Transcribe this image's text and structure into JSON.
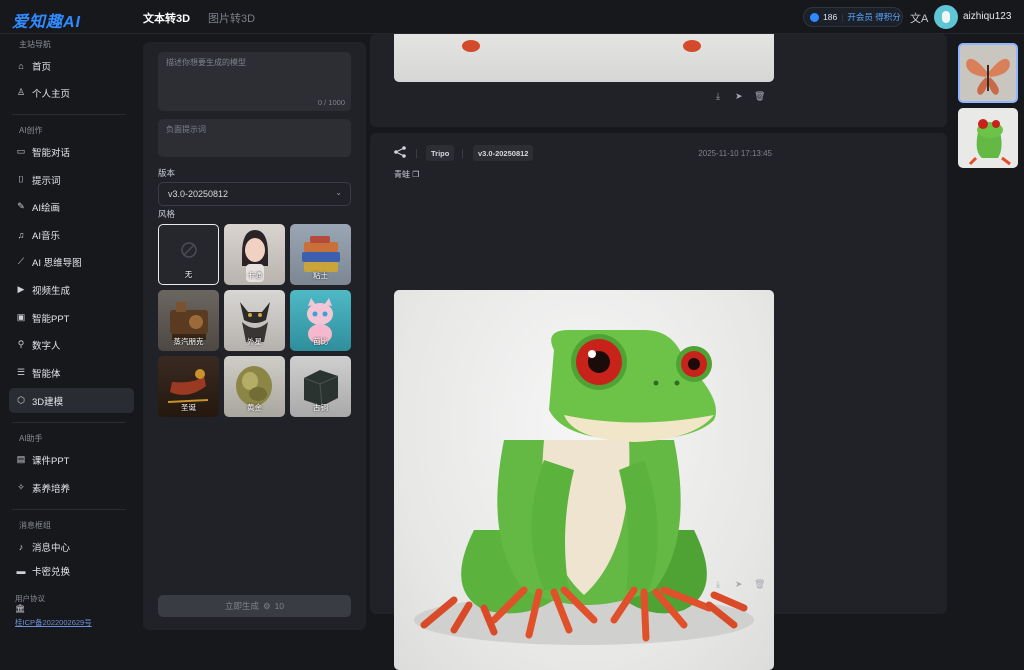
{
  "brand": {
    "logo": "爱知趣AI"
  },
  "topbar": {
    "tabs": [
      {
        "label": "文本转3D",
        "active": true
      },
      {
        "label": "图片转3D",
        "active": false
      }
    ],
    "credits": {
      "count": "186",
      "vip": "开会员 得积分"
    },
    "translate_icon": "文A",
    "username": "aizhiqu123"
  },
  "sidebar": {
    "sections": [
      {
        "title": "主站导航",
        "items": [
          {
            "label": "首页",
            "icon": "home-icon"
          },
          {
            "label": "个人主页",
            "icon": "user-icon"
          }
        ]
      },
      {
        "title": "AI创作",
        "items": [
          {
            "label": "智能对话",
            "icon": "chat-icon"
          },
          {
            "label": "提示词",
            "icon": "bookmark-icon"
          },
          {
            "label": "AI绘画",
            "icon": "pen-icon"
          },
          {
            "label": "AI音乐",
            "icon": "music-icon"
          },
          {
            "label": "AI 思维导图",
            "icon": "chart-icon"
          },
          {
            "label": "视频生成",
            "icon": "play-icon"
          },
          {
            "label": "智能PPT",
            "icon": "ppt-icon"
          },
          {
            "label": "数字人",
            "icon": "person-icon"
          },
          {
            "label": "智能体",
            "icon": "list-icon"
          },
          {
            "label": "3D建模",
            "icon": "cube-icon",
            "active": true
          }
        ]
      },
      {
        "title": "AI助手",
        "items": [
          {
            "label": "课件PPT",
            "icon": "courseware-icon"
          },
          {
            "label": "素养培养",
            "icon": "sparkle-icon"
          }
        ]
      },
      {
        "title": "消息框组",
        "items": [
          {
            "label": "消息中心",
            "icon": "bell-icon"
          },
          {
            "label": "卡密兑换",
            "icon": "card-icon"
          }
        ]
      }
    ],
    "footer": {
      "agreement": "用户协议",
      "icp": "桂ICP备2022002629号"
    }
  },
  "form": {
    "prompt_placeholder": "描述你想要生成的模型",
    "prompt_count": "0 / 1000",
    "negative_placeholder": "负面提示词",
    "version_label": "版本",
    "version_value": "v3.0-20250812",
    "style_label": "风格",
    "styles": [
      {
        "name": "无",
        "selected": true
      },
      {
        "name": "卡通"
      },
      {
        "name": "粘土"
      },
      {
        "name": "蒸汽朋克"
      },
      {
        "name": "外星"
      },
      {
        "name": "芭比"
      },
      {
        "name": "圣诞"
      },
      {
        "name": "黄金"
      },
      {
        "name": "古铜"
      }
    ],
    "generate_label": "立即生成",
    "generate_cost": "10"
  },
  "results": {
    "card": {
      "provider": "Tripo",
      "version": "v3.0-20250812",
      "timestamp": "2025-11-10 17:13:45",
      "prompt": "青蛙"
    }
  }
}
